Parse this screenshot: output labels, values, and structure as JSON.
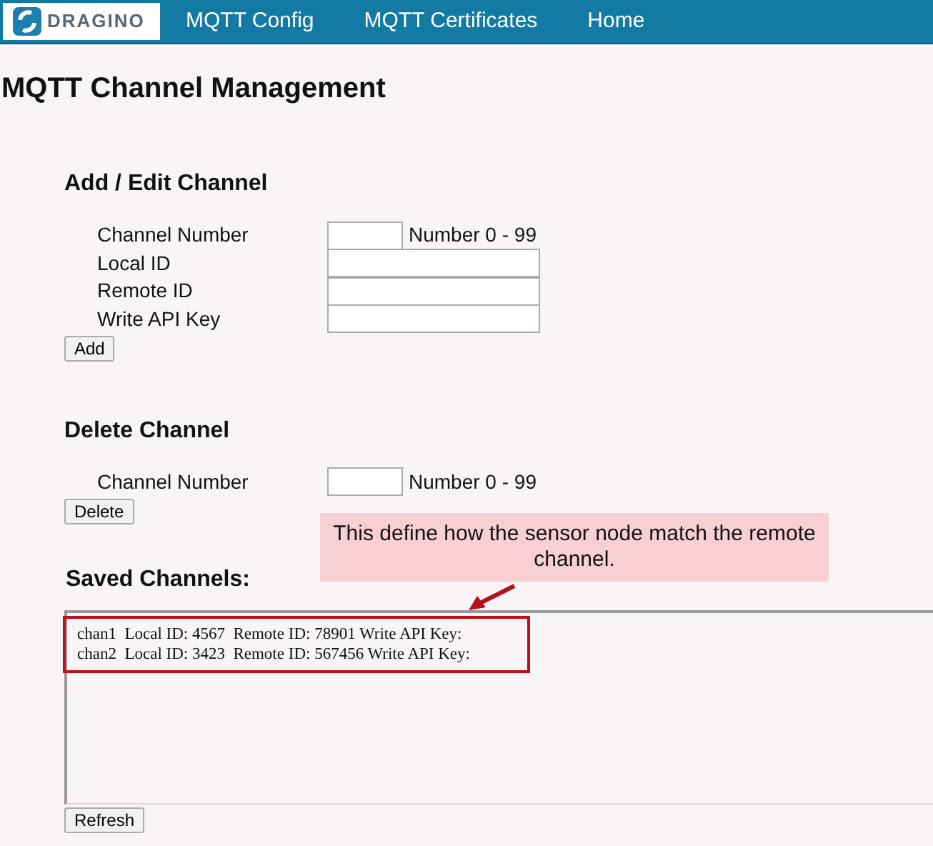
{
  "nav": {
    "logo": "DRAGINO",
    "links": [
      {
        "label": "MQTT Config"
      },
      {
        "label": "MQTT Certificates"
      },
      {
        "label": "Home"
      }
    ]
  },
  "page_title": "MQTT Channel Management",
  "add_section": {
    "heading": "Add / Edit Channel",
    "fields": [
      {
        "label": "Channel Number",
        "kind": "short",
        "hint": "Number 0 - 99"
      },
      {
        "label": "Local ID",
        "kind": "long"
      },
      {
        "label": "Remote ID",
        "kind": "long"
      },
      {
        "label": "Write API Key",
        "kind": "long"
      }
    ],
    "button": "Add"
  },
  "delete_section": {
    "heading": "Delete Channel",
    "fields": [
      {
        "label": "Channel Number",
        "kind": "short",
        "hint": "Number 0 - 99"
      }
    ],
    "button": "Delete"
  },
  "saved_section": {
    "heading": "Saved Channels:",
    "lines": [
      "chan1  Local ID: 4567  Remote ID: 78901 Write API Key:",
      "chan2  Local ID: 3423  Remote ID: 567456 Write API Key:"
    ],
    "button": "Refresh"
  },
  "annotation": {
    "text": "This define how the sensor node match the remote channel."
  }
}
